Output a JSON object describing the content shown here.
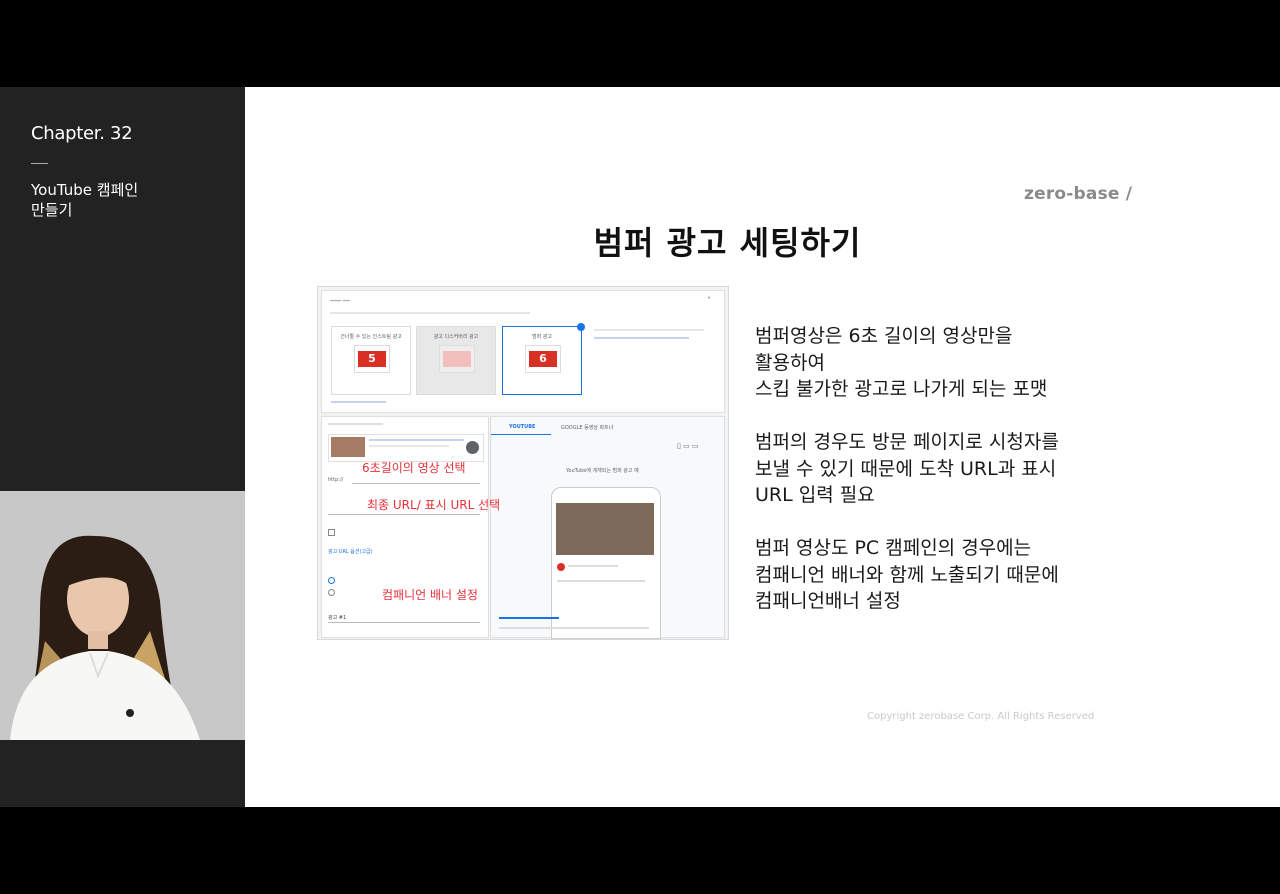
{
  "sidebar": {
    "chapter": "Chapter. 32",
    "topic_line1": "YouTube 캠페인",
    "topic_line2": "만들기"
  },
  "slide": {
    "logo": "zero-base /",
    "title": "범퍼 광고 세팅하기",
    "paragraph1": [
      "범퍼영상은 6초 길이의 영상만을",
      "활용하여",
      "스킵 불가한 광고로 나가게 되는 포맷"
    ],
    "paragraph2": [
      "범퍼의 경우도 방문 페이지로 시청자를",
      "보낼 수 있기 때문에 도착 URL과 표시",
      "URL 입력 필요"
    ],
    "paragraph3": [
      "범퍼 영상도 PC 캠페인의 경우에는",
      "컴패니언 배너와 함께 노출되기 때문에",
      "컴패니언배너 설정"
    ],
    "copyright": "Copyright zerobase Corp. All Rights Reserved"
  },
  "screenshot": {
    "annotations": {
      "select_video": "6초길이의 영상 선택",
      "select_url": "최종 URL/ 표시 URL 선택",
      "companion_banner": "컴패니언 배너 설정"
    },
    "cards": [
      {
        "label": "건너뛸 수 있는 인스트림 광고",
        "num": "5"
      },
      {
        "label": "광고 디스커버리 광고",
        "num": ""
      },
      {
        "label": "범퍼 광고",
        "num": "6"
      }
    ],
    "tabs": [
      "YOUTUBE",
      "GOOGLE 동영상 파트너"
    ],
    "url_prefix": "http://",
    "expand_link": "광고 URL 옵션(고급)",
    "preview_caption": "YouTube에 게재되는 범퍼 광고 예",
    "ad_name": "광고 #1"
  }
}
